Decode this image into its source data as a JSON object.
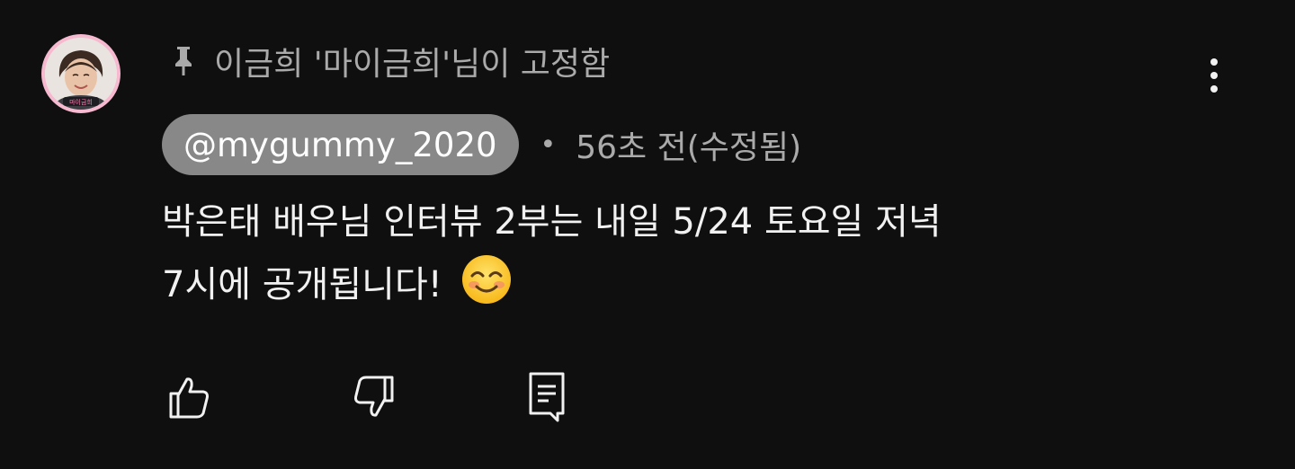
{
  "comment": {
    "pinned_label": "이금희 '마이금희'님이 고정함",
    "author": "@mygummy_2020",
    "separator": "•",
    "timestamp": "56초 전(수정됨)",
    "body_line1": "박은태 배우님 인터뷰 2부는 내일 5/24 토요일 저녁",
    "body_line2": "7시에 공개됩니다!",
    "emoji": "smiling-face-icon",
    "avatar_caption": "마이금희"
  },
  "icons": {
    "pin": "pin-icon",
    "more": "more-vertical-icon",
    "like": "thumbs-up-icon",
    "dislike": "thumbs-down-icon",
    "reply": "reply-comment-icon"
  },
  "colors": {
    "background": "#0f0f0f",
    "text_primary": "#f1f1f1",
    "text_secondary": "#aaaaaa",
    "author_chip": "#888888",
    "avatar_ring": "#f6b9cf"
  }
}
